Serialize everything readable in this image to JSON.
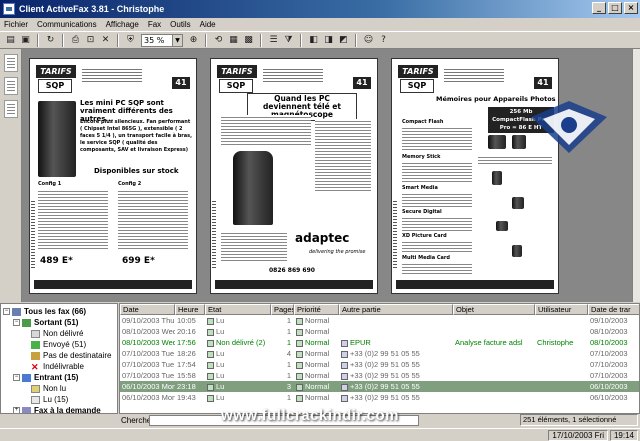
{
  "window": {
    "title": "Client ActiveFax 3.81 - Christophe"
  },
  "menu": [
    "Fichier",
    "Communications",
    "Affichage",
    "Fax",
    "Outils",
    "Aide"
  ],
  "toolbar": {
    "zoom": "35 %"
  },
  "pages": [
    {
      "tarifs": "TARIFS",
      "logo": "SQP",
      "page_number": "41",
      "headline": "Les mini PC SQP sont vraiment différents des autres...",
      "body": "Encore plus silencieux. Fan performant ( Chipset Intel 865G ), extensible ( 2 faces 5 1/4 ), un transport facile à bras, le service SQP ( qualité des composants, SAV et livraison Express)",
      "stock": "Disponibles sur stock",
      "config1": "Config 1",
      "config2": "Config 2",
      "price1": "489 E*",
      "price2": "699 E*"
    },
    {
      "headline": "Quand les PC deviennent télé et magnétoscope",
      "brand": "adaptec",
      "tagline": "delivering the promise",
      "phone": "0826 869 690"
    },
    {
      "headline": "Mémoires pour Appareils Photos",
      "promo": "256 Mb CompactFlash Prix Pro = 86 E HT",
      "sections": [
        "Compact Flash",
        "Memory Stick",
        "Smart Media",
        "Secure Digital",
        "XD Picture Card",
        "Multi Media Card"
      ]
    }
  ],
  "tree": [
    {
      "label": "Tous les fax (66)",
      "level": 0
    },
    {
      "label": "Sortant (51)",
      "level": 1
    },
    {
      "label": "Non délivré",
      "level": 2
    },
    {
      "label": "Envoyé (51)",
      "level": 2
    },
    {
      "label": "Pas de destinataire",
      "level": 2
    },
    {
      "label": "Indélivrable",
      "level": 2
    },
    {
      "label": "Entrant (15)",
      "level": 1
    },
    {
      "label": "Non lu",
      "level": 2
    },
    {
      "label": "Lu (15)",
      "level": 2
    },
    {
      "label": "Fax à la demande",
      "level": 1
    },
    {
      "label": "Corbeille (251)",
      "level": 0
    }
  ],
  "table": {
    "columns": [
      "Date",
      "Heure",
      "Etat",
      "Pages",
      "Priorité",
      "Autre partie",
      "Objet",
      "Utilisateur",
      "Date de trar"
    ],
    "rows": [
      {
        "date": "09/10/2003 Thu",
        "heure": "10:05",
        "etat": "Lu",
        "pages": "1",
        "priorite": "Normal",
        "partie": "",
        "objet": "",
        "user": "",
        "date2": "09/10/2003"
      },
      {
        "date": "08/10/2003 Wed",
        "heure": "20:16",
        "etat": "Lu",
        "pages": "1",
        "priorite": "Normal",
        "partie": "",
        "objet": "",
        "user": "",
        "date2": "08/10/2003"
      },
      {
        "date": "08/10/2003 Wed",
        "heure": "17:56",
        "etat": "Non délivré (2)",
        "pages": "1",
        "priorite": "Normal",
        "partie": "EPUR",
        "objet": "Analyse facture adsl",
        "user": "Christophe",
        "date2": "08/10/2003"
      },
      {
        "date": "07/10/2003 Tue",
        "heure": "18:26",
        "etat": "Lu",
        "pages": "4",
        "priorite": "Normal",
        "partie": "+33 (0)2 99 51 05 55",
        "objet": "",
        "user": "",
        "date2": "07/10/2003"
      },
      {
        "date": "07/10/2003 Tue",
        "heure": "17:54",
        "etat": "Lu",
        "pages": "1",
        "priorite": "Normal",
        "partie": "+33 (0)2 99 51 05 55",
        "objet": "",
        "user": "",
        "date2": "07/10/2003"
      },
      {
        "date": "07/10/2003 Tue",
        "heure": "15:58",
        "etat": "Lu",
        "pages": "1",
        "priorite": "Normal",
        "partie": "+33 (0)2 99 51 05 55",
        "objet": "",
        "user": "",
        "date2": "07/10/2003"
      },
      {
        "date": "06/10/2003 Mon",
        "heure": "23:18",
        "etat": "Lu",
        "pages": "3",
        "priorite": "Normal",
        "partie": "+33 (0)2 99 51 05 55",
        "objet": "",
        "user": "",
        "date2": "06/10/2003"
      },
      {
        "date": "06/10/2003 Mon",
        "heure": "19:43",
        "etat": "Lu",
        "pages": "1",
        "priorite": "Normal",
        "partie": "+33 (0)2 99 51 05 55",
        "objet": "",
        "user": "",
        "date2": "06/10/2003"
      }
    ]
  },
  "search": {
    "label": "Chercher:",
    "value": "",
    "count": "251 éléments, 1 sélectionné"
  },
  "status": {
    "datetime": "17/10/2003 Fri",
    "time": "19:14"
  },
  "watermark": "www.fullcrackindir.com"
}
